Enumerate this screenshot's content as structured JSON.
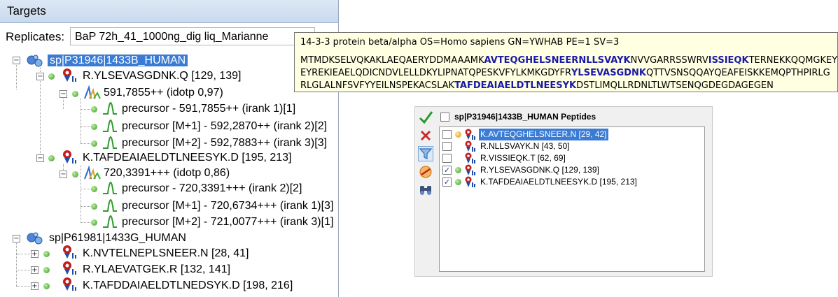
{
  "targets": {
    "title": "Targets",
    "replicates_label": "Replicates:",
    "replicate_value": "BaP 72h_41_1000ng_dig liq_Marianne",
    "tree": {
      "protein1": "sp|P31946|1433B_HUMAN",
      "pep1": "R.YLSEVASGDNK.Q [129, 139]",
      "pep1_prec": "591,7855++ (idotp 0,97)",
      "pep1_t1": "precursor - 591,7855++ (irank 1)[1]",
      "pep1_t2": "precursor [M+1] - 592,2870++ (irank 2)[2]",
      "pep1_t3": "precursor [M+2] - 592,7883++ (irank 3)[3]",
      "pep2": "K.TAFDEAIAELDTLNEESYK.D [195, 213]",
      "pep2_prec": "720,3391+++ (idotp 0,86)",
      "pep2_t1": "precursor - 720,3391+++ (irank 2)[2]",
      "pep2_t2": "precursor [M+1] - 720,6734+++ (irank 1)[3]",
      "pep2_t3": "precursor [M+2] - 721,0077+++ (irank 3)[1]",
      "protein2": "sp|P61981|1433G_HUMAN",
      "pep3": "K.NVTELNEPLSNEER.N [28, 41]",
      "pep4": "R.YLAEVATGEK.R [132, 141]",
      "pep5": "K.TAFDDAIAELDTLNEDSYK.D [198, 216]"
    }
  },
  "tooltip": {
    "title": "14-3-3 protein beta/alpha OS=Homo sapiens GN=YWHAB PE=1 SV=3",
    "l1a": "MTMDKSELVQKAKLAEQAERYDDMAAAMK",
    "l1b": "AVTEQGHELSNEERNLLSVAYK",
    "l1c": "NVVGARRSSWRV",
    "l1d": "ISSIEQK",
    "l1e": "TERNEKKQQMGKEYRE",
    "l2a": "EYREKIEAELQDICNDVLELLDKYLIPNATQPESKVFYLKMKGDYFR",
    "l2b": "YLSEVASGDNK",
    "l2c": "QTTVSNSQQAYQEAFEISKKEMQPTHPIRLG",
    "l3a": "RLGLALNFSVFYYEILNSPEKACSLAK",
    "l3b": "TAFDEAIAELDTLNEESYK",
    "l3c": "DSTLIMQLLRDNLTLWTSENQGDEGDAGEGEN"
  },
  "peptides": {
    "header": "sp|P31946|1433B_HUMAN Peptides",
    "rows": [
      {
        "label": "K.AVTEQGHELSNEER.N [29, 42]",
        "checked": false
      },
      {
        "label": "R.NLLSVAYK.N [43, 50]",
        "checked": false
      },
      {
        "label": "R.VISSIEQK.T [62, 69]",
        "checked": false
      },
      {
        "label": "R.YLSEVASGDNK.Q [129, 139]",
        "checked": true
      },
      {
        "label": "K.TAFDEAIAELDTLNEESYK.D [195, 213]",
        "checked": true
      }
    ],
    "check_glyph": "✓"
  },
  "icons": {
    "accept": "check-icon",
    "reject": "x-icon",
    "filter": "filter-icon",
    "library": "library-icon",
    "find": "binoculars-icon"
  },
  "colors": {
    "selection": "#3a7bd5",
    "tooltip_bg": "#ffffe1",
    "highlight_seq": "#1a1aa8"
  }
}
